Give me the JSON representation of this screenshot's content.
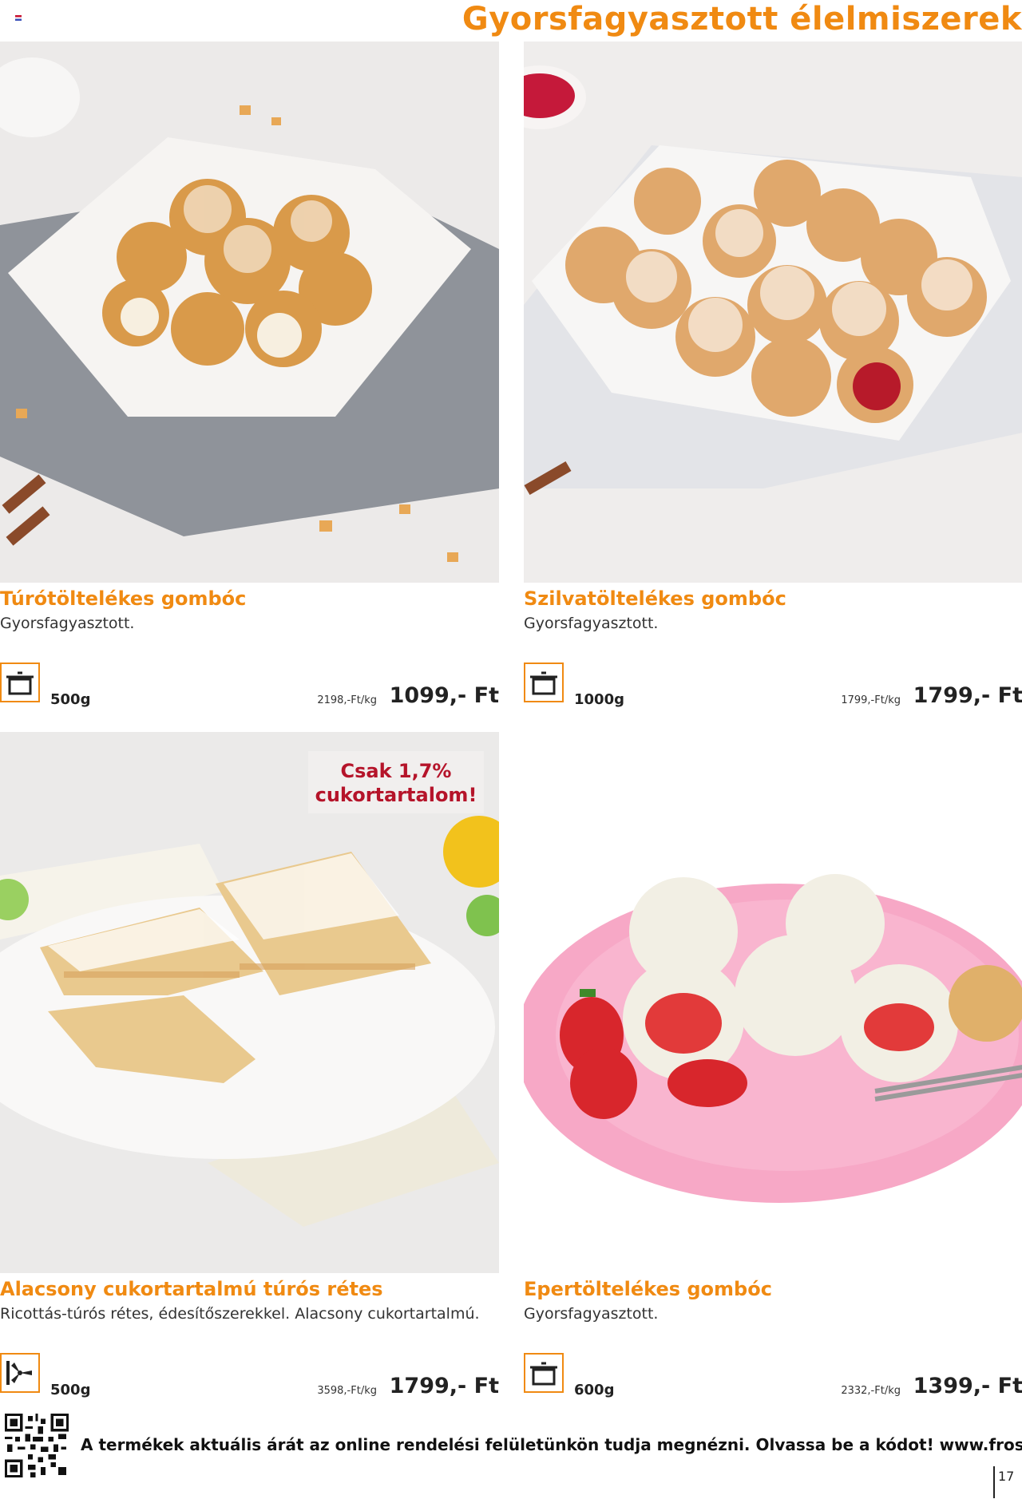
{
  "header": {
    "title": "Gyorsfagyasztott élelmiszerek"
  },
  "products": [
    {
      "name": "Túrótöltelékes gombóc",
      "description": "Gyorsfagyasztott.",
      "prep_icon": "pot-icon",
      "weight": "500g",
      "unit_price": "2198,-Ft/kg",
      "price": "1099,- Ft"
    },
    {
      "name": "Szilvatöltelékes gombóc",
      "description": "Gyorsfagyasztott.",
      "prep_icon": "pot-icon",
      "weight": "1000g",
      "unit_price": "1799,-Ft/kg",
      "price": "1799,- Ft"
    },
    {
      "name": "Alacsony cukortartalmú túrós rétes",
      "description": "Ricottás-túrós rétes, édesítőszerekkel. Alacsony cukortartalmú.",
      "prep_icon": "fan-oven-icon",
      "weight": "500g",
      "unit_price": "3598,-Ft/kg",
      "price": "1799,- Ft",
      "badge": {
        "line1": "Csak 1,7%",
        "line2": "cukortartalom!"
      }
    },
    {
      "name": "Epertöltelékes gombóc",
      "description": "Gyorsfagyasztott.",
      "prep_icon": "pot-icon",
      "weight": "600g",
      "unit_price": "2332,-Ft/kg",
      "price": "1399,- Ft"
    }
  ],
  "footer": {
    "note": "A termékek aktuális árát az online rendelési felületünkön tudja megnézni. Olvassa be a kódot! www.frost.hu",
    "page_number": "17"
  },
  "colors": {
    "accent": "#f08a12",
    "badge_text": "#b5142a"
  }
}
